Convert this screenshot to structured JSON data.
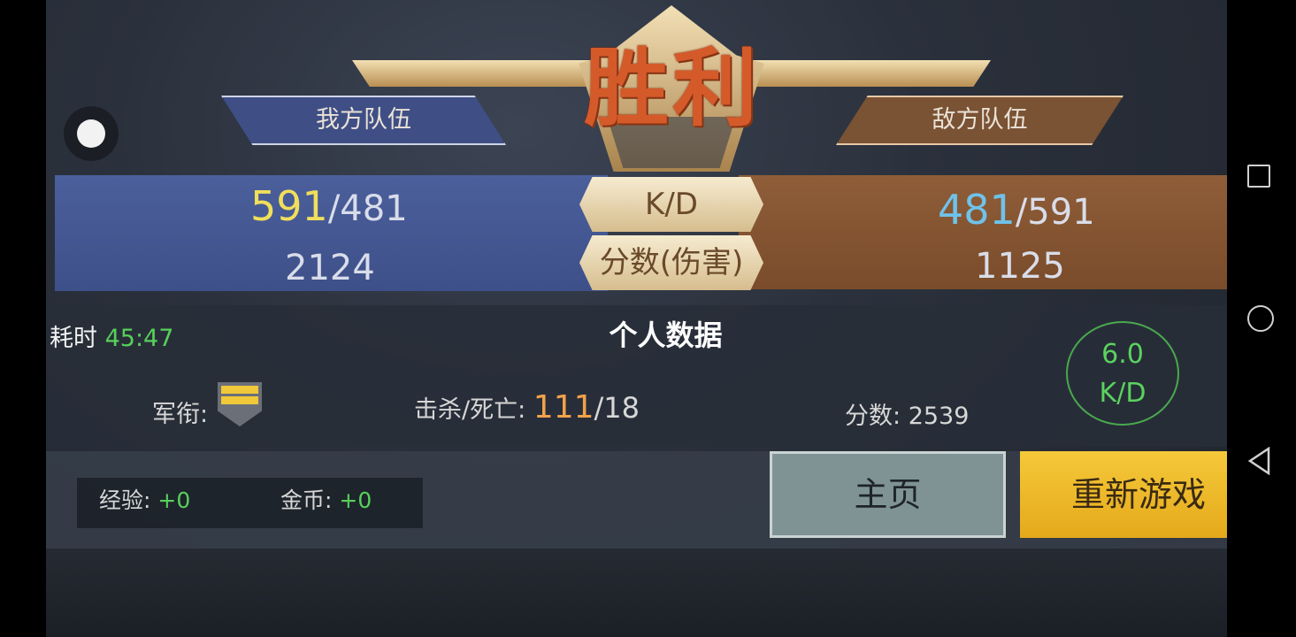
{
  "result_title": "胜利",
  "teams": {
    "ally_label": "我方队伍",
    "enemy_label": "敌方队伍"
  },
  "center_labels": {
    "kd": "K/D",
    "score": "分数(伤害)"
  },
  "ally": {
    "kills": "591",
    "deaths": "/481",
    "score": "2124"
  },
  "enemy": {
    "kills": "481",
    "deaths": "/591",
    "score": "1125"
  },
  "duration": {
    "label": "耗时",
    "value": "45:47"
  },
  "personal": {
    "title": "个人数据",
    "rank_label": "军衔:",
    "kd_label": "击杀/死亡:",
    "kills": "111",
    "deaths": "/18",
    "score_label": "分数:",
    "score": "2539",
    "kd_ratio": "6.0",
    "kd_ratio_label": "K/D"
  },
  "rewards": {
    "exp_label": "经验:",
    "exp": "+0",
    "gold_label": "金币:",
    "gold": "+0"
  },
  "buttons": {
    "home": "主页",
    "restart": "重新游戏"
  },
  "colors": {
    "accent_green": "#57d05a",
    "ally_blue": "#3e5089",
    "enemy_brown": "#7a4c2b",
    "restart_yellow": "#f0bd2c"
  }
}
